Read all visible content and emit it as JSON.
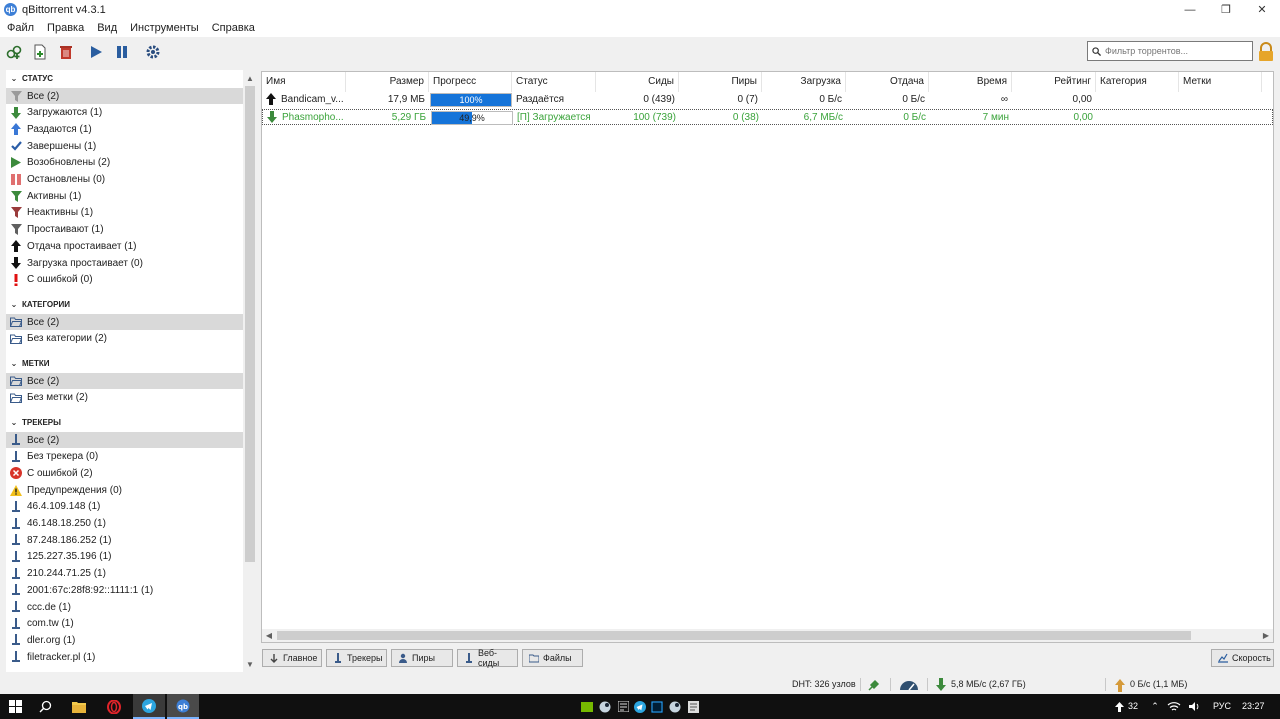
{
  "window": {
    "title": "qBittorrent v4.3.1",
    "app_icon_glyph": "qb",
    "minimize": "—",
    "maximize": "❐",
    "close": "✕"
  },
  "menu": [
    "Файл",
    "Правка",
    "Вид",
    "Инструменты",
    "Справка"
  ],
  "toolbar": {
    "filter_placeholder": "Фильтр торрентов...",
    "icons": [
      "add-torrent-link-icon",
      "add-torrent-file-icon",
      "delete-icon",
      "resume-icon",
      "pause-icon",
      "options-icon"
    ]
  },
  "sidebar": {
    "status": {
      "title": "СТАТУС",
      "items": [
        {
          "label": "Все (2)",
          "icon": "filter-icon",
          "color": "#9a9a9a",
          "selected": true
        },
        {
          "label": "Загружаются (1)",
          "icon": "download-arrow-icon",
          "color": "#3c8a3c"
        },
        {
          "label": "Раздаются (1)",
          "icon": "upload-arrow-icon",
          "color": "#3a78d6"
        },
        {
          "label": "Завершены (1)",
          "icon": "checkmark-icon",
          "color": "#2b5ea8"
        },
        {
          "label": "Возобновлены (2)",
          "icon": "play-icon",
          "color": "#3c8a3c"
        },
        {
          "label": "Остановлены (0)",
          "icon": "pause-icon",
          "color": "#e07070"
        },
        {
          "label": "Активны (1)",
          "icon": "filter-icon",
          "color": "#3c8a3c"
        },
        {
          "label": "Неактивны (1)",
          "icon": "filter-icon",
          "color": "#9a3b3b"
        },
        {
          "label": "Простаивают (1)",
          "icon": "filter-icon",
          "color": "#606060"
        },
        {
          "label": "Отдача простаивает (1)",
          "icon": "upload-arrow-icon",
          "color": "#111111"
        },
        {
          "label": "Загрузка простаивает (0)",
          "icon": "download-arrow-icon",
          "color": "#111111"
        },
        {
          "label": "С ошибкой (0)",
          "icon": "exclamation-icon",
          "color": "#e01010"
        }
      ]
    },
    "categories": {
      "title": "КАТЕГОРИИ",
      "items": [
        {
          "label": "Все (2)",
          "icon": "folder-icon",
          "selected": true
        },
        {
          "label": "Без категории (2)",
          "icon": "folder-icon"
        }
      ]
    },
    "tags": {
      "title": "МЕТКИ",
      "items": [
        {
          "label": "Все (2)",
          "icon": "folder-icon",
          "selected": true
        },
        {
          "label": "Без метки (2)",
          "icon": "folder-icon"
        }
      ]
    },
    "trackers": {
      "title": "ТРЕКЕРЫ",
      "items": [
        {
          "label": "Все (2)",
          "icon": "tracker-icon",
          "selected": true
        },
        {
          "label": "Без трекера (0)",
          "icon": "tracker-icon"
        },
        {
          "label": "С ошибкой (2)",
          "icon": "error-circle-icon"
        },
        {
          "label": "Предупреждения (0)",
          "icon": "warning-icon"
        },
        {
          "label": "46.4.109.148 (1)",
          "icon": "tracker-icon"
        },
        {
          "label": "46.148.18.250 (1)",
          "icon": "tracker-icon"
        },
        {
          "label": "87.248.186.252 (1)",
          "icon": "tracker-icon"
        },
        {
          "label": "125.227.35.196 (1)",
          "icon": "tracker-icon"
        },
        {
          "label": "210.244.71.25 (1)",
          "icon": "tracker-icon"
        },
        {
          "label": "2001:67c:28f8:92::1111:1 (1)",
          "icon": "tracker-icon"
        },
        {
          "label": "ccc.de (1)",
          "icon": "tracker-icon"
        },
        {
          "label": "com.tw (1)",
          "icon": "tracker-icon"
        },
        {
          "label": "dler.org (1)",
          "icon": "tracker-icon"
        },
        {
          "label": "filetracker.pl (1)",
          "icon": "tracker-icon"
        }
      ]
    }
  },
  "table": {
    "columns": [
      "Имя",
      "Размер",
      "Прогресс",
      "Статус",
      "Сиды",
      "Пиры",
      "Загрузка",
      "Отдача",
      "Время",
      "Рейтинг",
      "Категория",
      "Метки"
    ],
    "rows": [
      {
        "icon": "upload-arrow-icon",
        "name": "Bandicam_v...",
        "size": "17,9 МБ",
        "progress": 1.0,
        "progress_text": "100%",
        "status": "Раздаётся",
        "seeds": "0 (439)",
        "peers": "0 (7)",
        "down": "0 Б/с",
        "up": "0 Б/с",
        "eta": "∞",
        "ratio": "0,00",
        "category": "",
        "tags": "",
        "downloading": false
      },
      {
        "icon": "download-arrow-icon",
        "name": "Phasmopho...",
        "size": "5,29 ГБ",
        "progress": 0.499,
        "progress_text": "49,9%",
        "status": "[П] Загружается",
        "seeds": "100 (739)",
        "peers": "0 (38)",
        "down": "6,7 МБ/с",
        "up": "0 Б/с",
        "eta": "7 мин",
        "ratio": "0,00",
        "category": "",
        "tags": "",
        "downloading": true
      }
    ]
  },
  "tabs": {
    "general": "Главное",
    "trackers": "Трекеры",
    "peers": "Пиры",
    "webseeds": "Веб-сиды",
    "files": "Файлы",
    "speed": "Скорость"
  },
  "statusbar": {
    "dht": "DHT: 326 узлов",
    "download": "5,8 МБ/с (2,67 ГБ)",
    "upload": "0 Б/с (1,1 МБ)"
  },
  "taskbar": {
    "tray_count": "32",
    "language": "РУС",
    "time": "23:27"
  },
  "colors": {
    "accent": "#1574d9",
    "downloading_text": "#3aa33a",
    "selection": "#d9d9d9"
  }
}
